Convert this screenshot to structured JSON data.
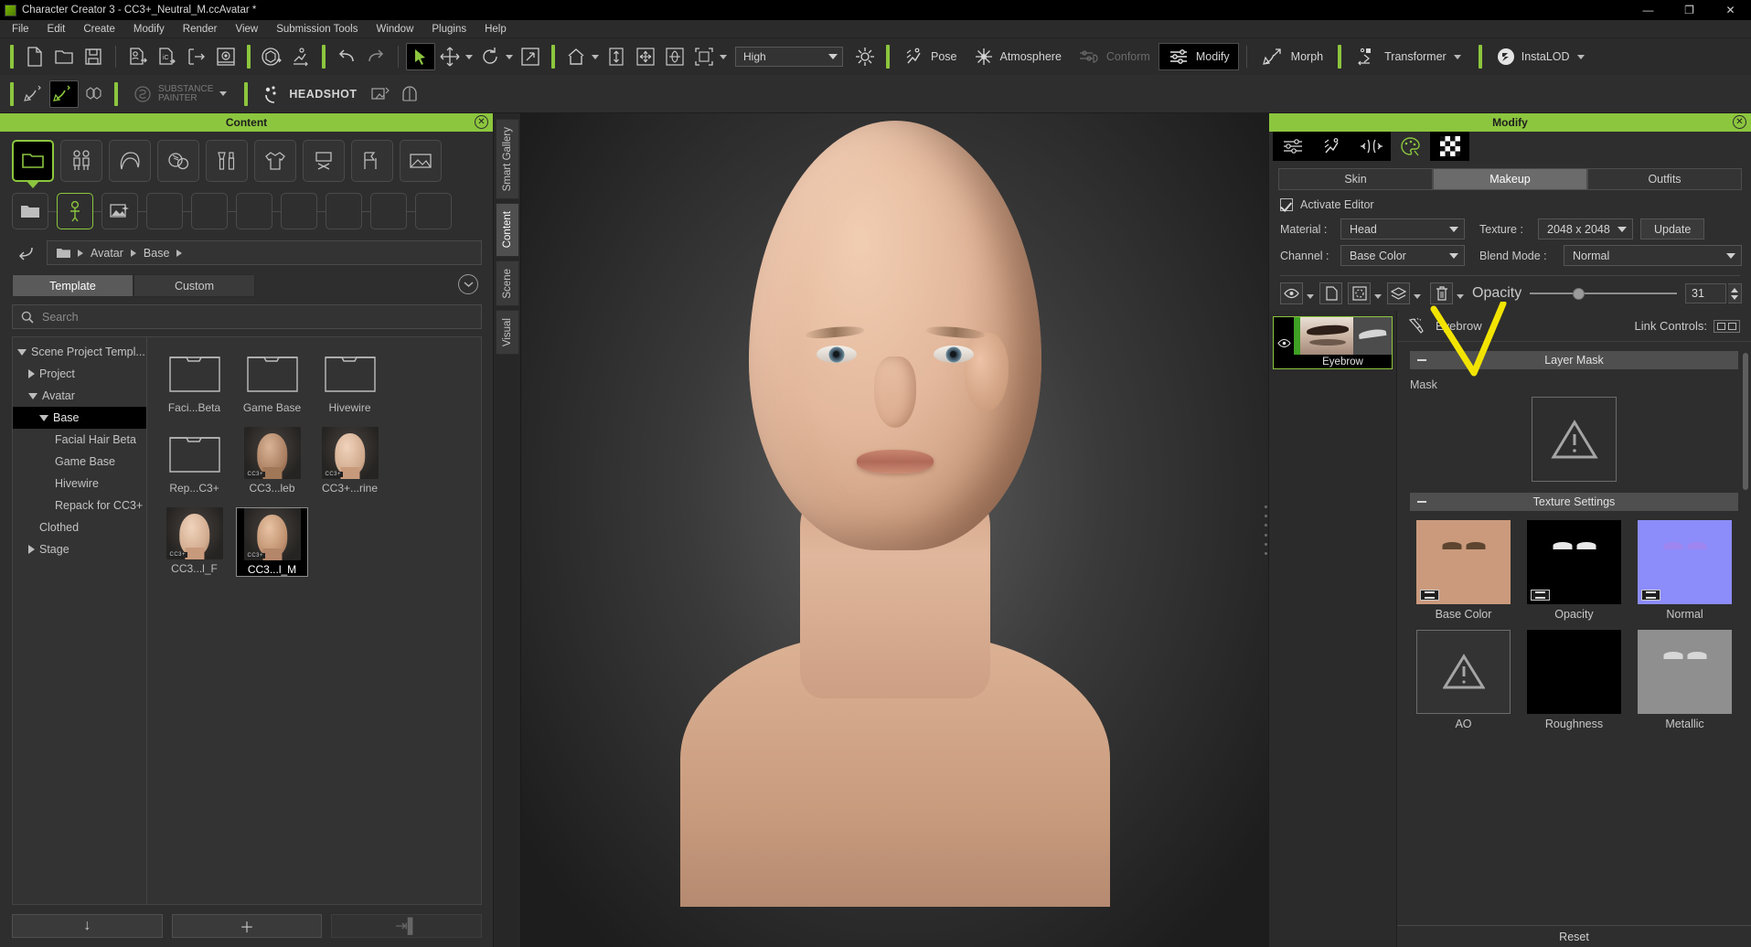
{
  "window": {
    "title": "Character Creator 3 - CC3+_Neutral_M.ccAvatar *",
    "minimize": "—",
    "maximize": "❐",
    "close": "✕"
  },
  "menubar": [
    "File",
    "Edit",
    "Create",
    "Modify",
    "Render",
    "View",
    "Submission Tools",
    "Window",
    "Plugins",
    "Help"
  ],
  "toolbar": {
    "quality_value": "High",
    "modes": [
      {
        "label": "Pose",
        "icon": "pose-icon",
        "state": "normal"
      },
      {
        "label": "Atmosphere",
        "icon": "atmosphere-icon",
        "state": "normal"
      },
      {
        "label": "Conform",
        "icon": "conform-icon",
        "state": "disabled"
      },
      {
        "label": "Modify",
        "icon": "modify-icon",
        "state": "selected"
      },
      {
        "label": "Morph",
        "icon": "morph-icon",
        "state": "normal"
      },
      {
        "label": "Transformer",
        "icon": "transformer-icon",
        "state": "normal"
      },
      {
        "label": "InstaLOD",
        "icon": "instalod-icon",
        "state": "normal"
      }
    ],
    "row2": {
      "substance_line1": "SUBSTANCE",
      "substance_line2": "PAINTER",
      "headshot": "HEADSHOT"
    }
  },
  "content_panel": {
    "title": "Content",
    "close_icon": "✕",
    "categories": [
      {
        "name": "folder-category-icon",
        "selected": true
      },
      {
        "name": "characters-category-icon",
        "selected": false
      },
      {
        "name": "hair-category-icon",
        "selected": false
      },
      {
        "name": "skin-category-icon",
        "selected": false
      },
      {
        "name": "makeup-category-icon",
        "selected": false
      },
      {
        "name": "cloth-category-icon",
        "selected": false
      },
      {
        "name": "prop-category-icon",
        "selected": false
      },
      {
        "name": "pose-category-icon",
        "selected": false
      },
      {
        "name": "scene-category-icon",
        "selected": false
      }
    ],
    "subcategories": [
      {
        "name": "folder-sub-icon",
        "selected": false
      },
      {
        "name": "avatar-sub-icon",
        "selected": true
      },
      {
        "name": "image-sub-icon",
        "selected": false
      },
      {
        "name": "empty-sub-1",
        "selected": false
      },
      {
        "name": "empty-sub-2",
        "selected": false
      },
      {
        "name": "empty-sub-3",
        "selected": false
      },
      {
        "name": "empty-sub-4",
        "selected": false
      },
      {
        "name": "empty-sub-5",
        "selected": false
      },
      {
        "name": "empty-sub-6",
        "selected": false
      },
      {
        "name": "empty-sub-7",
        "selected": false
      }
    ],
    "breadcrumb": [
      "Avatar",
      "Base"
    ],
    "tabs": [
      {
        "label": "Template",
        "selected": true
      },
      {
        "label": "Custom",
        "selected": false
      }
    ],
    "search": {
      "value": "",
      "placeholder": "Search"
    },
    "tree": [
      {
        "label": "Scene Project Templ...",
        "depth": 0,
        "twisty": "open",
        "selected": false
      },
      {
        "label": "Project",
        "depth": 1,
        "twisty": "closed",
        "selected": false
      },
      {
        "label": "Avatar",
        "depth": 1,
        "twisty": "open",
        "selected": false
      },
      {
        "label": "Base",
        "depth": 2,
        "twisty": "open",
        "selected": true
      },
      {
        "label": "Facial Hair Beta",
        "depth": 3,
        "twisty": "none",
        "selected": false
      },
      {
        "label": "Game Base",
        "depth": 3,
        "twisty": "none",
        "selected": false
      },
      {
        "label": "Hivewire",
        "depth": 3,
        "twisty": "none",
        "selected": false
      },
      {
        "label": "Repack for CC3+",
        "depth": 3,
        "twisty": "none",
        "selected": false
      },
      {
        "label": "Clothed",
        "depth": 2,
        "twisty": "none",
        "selected": false
      },
      {
        "label": "Stage",
        "depth": 1,
        "twisty": "closed",
        "selected": false
      }
    ],
    "items": [
      {
        "label": "Faci...Beta",
        "type": "folder",
        "selected": false
      },
      {
        "label": "Game Base",
        "type": "folder",
        "selected": false
      },
      {
        "label": "Hivewire",
        "type": "folder",
        "selected": false
      },
      {
        "label": "Rep...C3+",
        "type": "folder",
        "selected": false
      },
      {
        "label": "CC3...leb",
        "type": "avatar-male",
        "selected": false
      },
      {
        "label": "CC3+...rine",
        "type": "avatar-female",
        "selected": false
      },
      {
        "label": "CC3...l_F",
        "type": "avatar-female",
        "selected": false
      },
      {
        "label": "CC3...l_M",
        "type": "avatar-male",
        "selected": true
      }
    ],
    "footer": [
      {
        "name": "import-button",
        "icon": "↓",
        "disabled": false
      },
      {
        "name": "add-button",
        "icon": "＋",
        "disabled": false
      },
      {
        "name": "transfer-button",
        "icon": "⇥▌",
        "disabled": true
      }
    ]
  },
  "sidetabs": [
    {
      "label": "Smart Gallery",
      "selected": false
    },
    {
      "label": "Content",
      "selected": true
    },
    {
      "label": "Scene",
      "selected": false
    },
    {
      "label": "Visual",
      "selected": false
    }
  ],
  "modify_panel": {
    "title": "Modify",
    "close_icon": "✕",
    "tabs": [
      {
        "name": "adjust-tab-icon",
        "selected": false
      },
      {
        "name": "pose-tab-icon",
        "selected": false
      },
      {
        "name": "mesh-tab-icon",
        "selected": false
      },
      {
        "name": "material-tab-icon",
        "selected": true
      },
      {
        "name": "checker-tab-icon",
        "selected": false
      }
    ],
    "segments": [
      {
        "label": "Skin",
        "selected": false
      },
      {
        "label": "Makeup",
        "selected": true
      },
      {
        "label": "Outfits",
        "selected": false
      }
    ],
    "activate_editor": {
      "label": "Activate Editor",
      "checked": true
    },
    "material": {
      "label": "Material :",
      "value": "Head"
    },
    "texture": {
      "label": "Texture :",
      "value": "2048 x 2048",
      "update_label": "Update"
    },
    "channel": {
      "label": "Channel :",
      "value": "Base Color"
    },
    "blend_mode": {
      "label": "Blend Mode :",
      "value": "Normal"
    },
    "layer_tools": [
      {
        "name": "visibility-tool-icon",
        "has_caret": true
      },
      {
        "name": "duplicate-tool-icon",
        "has_caret": false
      },
      {
        "name": "select-region-tool-icon",
        "has_caret": true
      },
      {
        "name": "merge-layers-tool-icon",
        "has_caret": true
      },
      {
        "name": "delete-layer-tool-icon",
        "has_caret": true
      }
    ],
    "opacity": {
      "label": "Opacity",
      "value": "31",
      "percent": 31
    },
    "layers": [
      {
        "name": "Eyebrow",
        "visible": true,
        "selected": true
      }
    ],
    "layer_title": {
      "icon": "makeup-brush-icon",
      "label": "Eyebrow"
    },
    "link_controls": {
      "label": "Link Controls:"
    },
    "sections": [
      {
        "label": "Layer Mask",
        "collapsed": false
      },
      {
        "label": "Texture Settings",
        "collapsed": false
      }
    ],
    "mask": {
      "label": "Mask",
      "state": "warning-icon"
    },
    "textures": [
      {
        "label": "Base Color",
        "kind": "skin",
        "color": "#cb9a7d",
        "linked": true
      },
      {
        "label": "Opacity",
        "kind": "black-brows",
        "color": "#000000",
        "linked": true
      },
      {
        "label": "Normal",
        "kind": "normal",
        "color": "#8c8cfa",
        "linked": true
      },
      {
        "label": "AO",
        "kind": "warning",
        "color": "#333333",
        "linked": false
      },
      {
        "label": "Roughness",
        "kind": "black",
        "color": "#000000",
        "linked": false
      },
      {
        "label": "Metallic",
        "kind": "gray-brows",
        "color": "#8f8f8f",
        "linked": false
      }
    ],
    "reset_label": "Reset"
  },
  "colors": {
    "accent_green": "#8cc63e",
    "panel_bg": "#2e2e2e",
    "highlight_yellow": "#f2e400"
  }
}
